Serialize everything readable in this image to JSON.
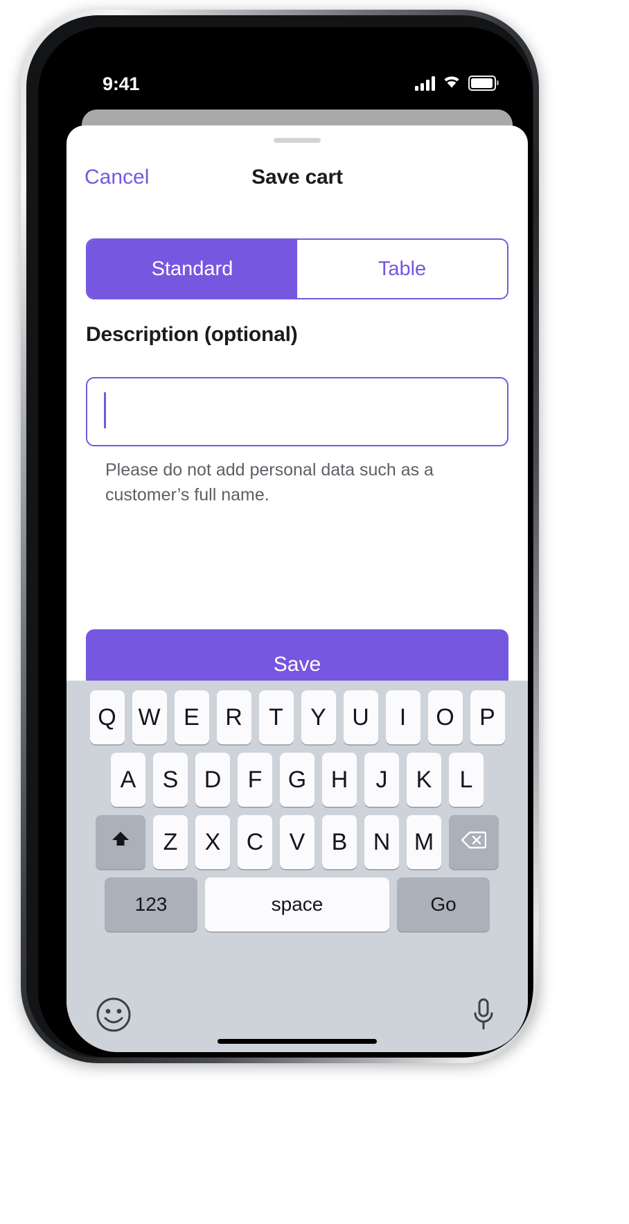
{
  "status_bar": {
    "time": "9:41",
    "cellular_icon": "signal-bars-icon",
    "wifi_icon": "wifi-icon",
    "battery_icon": "battery-icon"
  },
  "sheet": {
    "grabber": "drag-handle",
    "cancel_label": "Cancel",
    "title": "Save cart"
  },
  "segmented_control": {
    "options": [
      {
        "label": "Standard",
        "active": true
      },
      {
        "label": "Table",
        "active": false
      }
    ]
  },
  "description_field": {
    "label": "Description (optional)",
    "value": "",
    "placeholder": "",
    "helper_text": "Please do not add personal data such as a customer’s full name."
  },
  "primary_action": {
    "save_label": "Save"
  },
  "keyboard": {
    "row1": [
      "Q",
      "W",
      "E",
      "R",
      "T",
      "Y",
      "U",
      "I",
      "O",
      "P"
    ],
    "row2": [
      "A",
      "S",
      "D",
      "F",
      "G",
      "H",
      "J",
      "K",
      "L"
    ],
    "row3": [
      "Z",
      "X",
      "C",
      "V",
      "B",
      "N",
      "M"
    ],
    "shift_icon": "shift-arrow-icon",
    "backspace_icon": "backspace-icon",
    "numbers_label": "123",
    "space_label": "space",
    "return_label": "Go",
    "emoji_icon": "emoji-smiley-icon",
    "dictation_icon": "microphone-icon"
  },
  "colors": {
    "accent": "#7657e0",
    "title_text": "#1b1b1f",
    "helper_text": "#5e6066",
    "keyboard_bg": "#ced2d9",
    "key_bg": "#fbfbfd",
    "key_modifier_bg": "#abb0b9"
  }
}
